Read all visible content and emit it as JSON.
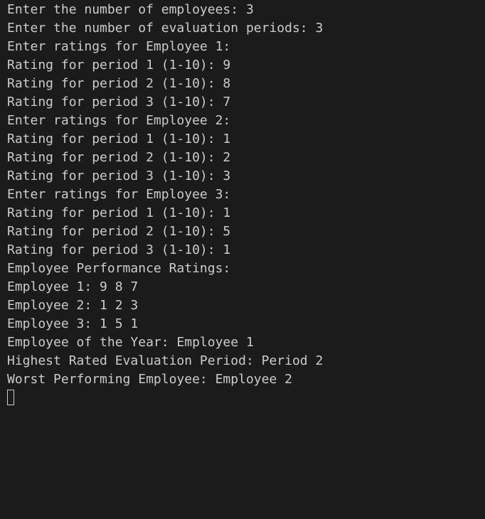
{
  "terminal": {
    "text_color": "#cccccc",
    "background_color": "#1b1b1b",
    "setup": [
      "Enter the number of employees: 3",
      "Enter the number of evaluation periods: 3"
    ],
    "employees_input": [
      {
        "header": "Enter ratings for Employee 1:",
        "ratings": [
          "Rating for period 1 (1-10): 9",
          "Rating for period 2 (1-10): 8",
          "Rating for period 3 (1-10): 7"
        ]
      },
      {
        "header": "Enter ratings for Employee 2:",
        "ratings": [
          "Rating for period 1 (1-10): 1",
          "Rating for period 2 (1-10): 2",
          "Rating for period 3 (1-10): 3"
        ]
      },
      {
        "header": "Enter ratings for Employee 3:",
        "ratings": [
          "Rating for period 1 (1-10): 1",
          "Rating for period 2 (1-10): 5",
          "Rating for period 3 (1-10): 1"
        ]
      }
    ],
    "summary": {
      "header": "Employee Performance Ratings:",
      "rows": [
        "Employee 1: 9 8 7",
        "Employee 2: 1 2 3",
        "Employee 3: 1 5 1"
      ]
    },
    "results": [
      "Employee of the Year: Employee 1",
      "Highest Rated Evaluation Period: Period 2",
      "Worst Performing Employee: Employee 2"
    ]
  }
}
